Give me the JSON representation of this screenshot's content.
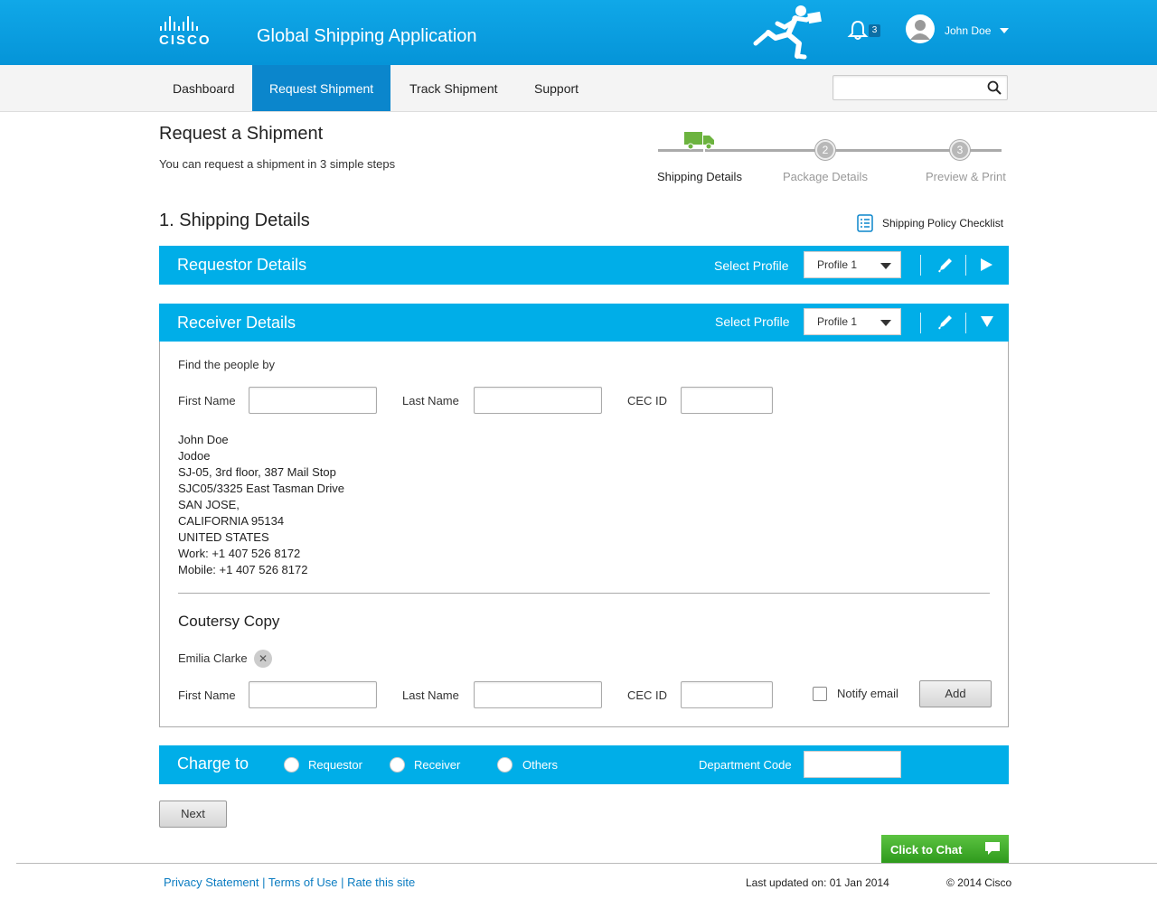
{
  "header": {
    "logo_text": "CISCO",
    "app_title": "Global Shipping Application",
    "notification_count": "3",
    "user_name": "John Doe"
  },
  "nav": {
    "items": [
      "Dashboard",
      "Request Shipment",
      "Track Shipment",
      "Support"
    ],
    "active": "Request Shipment",
    "search_placeholder": ""
  },
  "page": {
    "title": "Request a Shipment",
    "subtitle": "You can request a shipment in 3 simple steps"
  },
  "stepper": {
    "steps": [
      {
        "label": "Shipping Details",
        "number": "1",
        "active": true
      },
      {
        "label": "Package Details",
        "number": "2",
        "active": false
      },
      {
        "label": "Preview & Print",
        "number": "3",
        "active": false
      }
    ]
  },
  "section": {
    "title": "1. Shipping Details",
    "policy_link": "Shipping Policy Checklist"
  },
  "requestor": {
    "title": "Requestor Details",
    "select_label": "Select Profile",
    "profile": "Profile 1"
  },
  "receiver": {
    "title": "Receiver Details",
    "select_label": "Select Profile",
    "profile": "Profile 1",
    "find_label": "Find the people by",
    "first_name_label": "First Name",
    "last_name_label": "Last Name",
    "cec_label": "CEC ID",
    "first_name_value": "",
    "last_name_value": "",
    "cec_value": "",
    "address_lines": [
      "John Doe",
      "Jodoe",
      "SJ-05, 3rd floor, 387 Mail Stop",
      "SJC05/3325 East Tasman Drive",
      "SAN JOSE,",
      "CALIFORNIA 95134",
      "UNITED STATES",
      "Work: +1 407 526 8172",
      "Mobile: +1 407 526 8172"
    ]
  },
  "courtesy": {
    "title": "Coutersy Copy",
    "recipient": "Emilia Clarke",
    "first_name_label": "First Name",
    "last_name_label": "Last Name",
    "cec_label": "CEC ID",
    "notify_label": "Notify email",
    "notify_checked": false,
    "add_label": "Add"
  },
  "charge": {
    "title": "Charge to",
    "options": [
      "Requestor",
      "Receiver",
      "Others"
    ],
    "dept_label": "Department Code",
    "dept_value": ""
  },
  "actions": {
    "next_label": "Next",
    "chat_label": "Click to Chat"
  },
  "footer": {
    "links": [
      "Privacy Statement",
      "Terms of Use",
      "Rate this site"
    ],
    "updated": "Last updated on: 01 Jan 2014",
    "copyright": "© 2014 Cisco"
  },
  "colors": {
    "header_blue": "#0594d8",
    "nav_active": "#0b86cc",
    "bar_blue": "#00aee8",
    "truck_green": "#6cb33f",
    "chat_green": "#3aa826",
    "link_blue": "#0b7cc1"
  }
}
